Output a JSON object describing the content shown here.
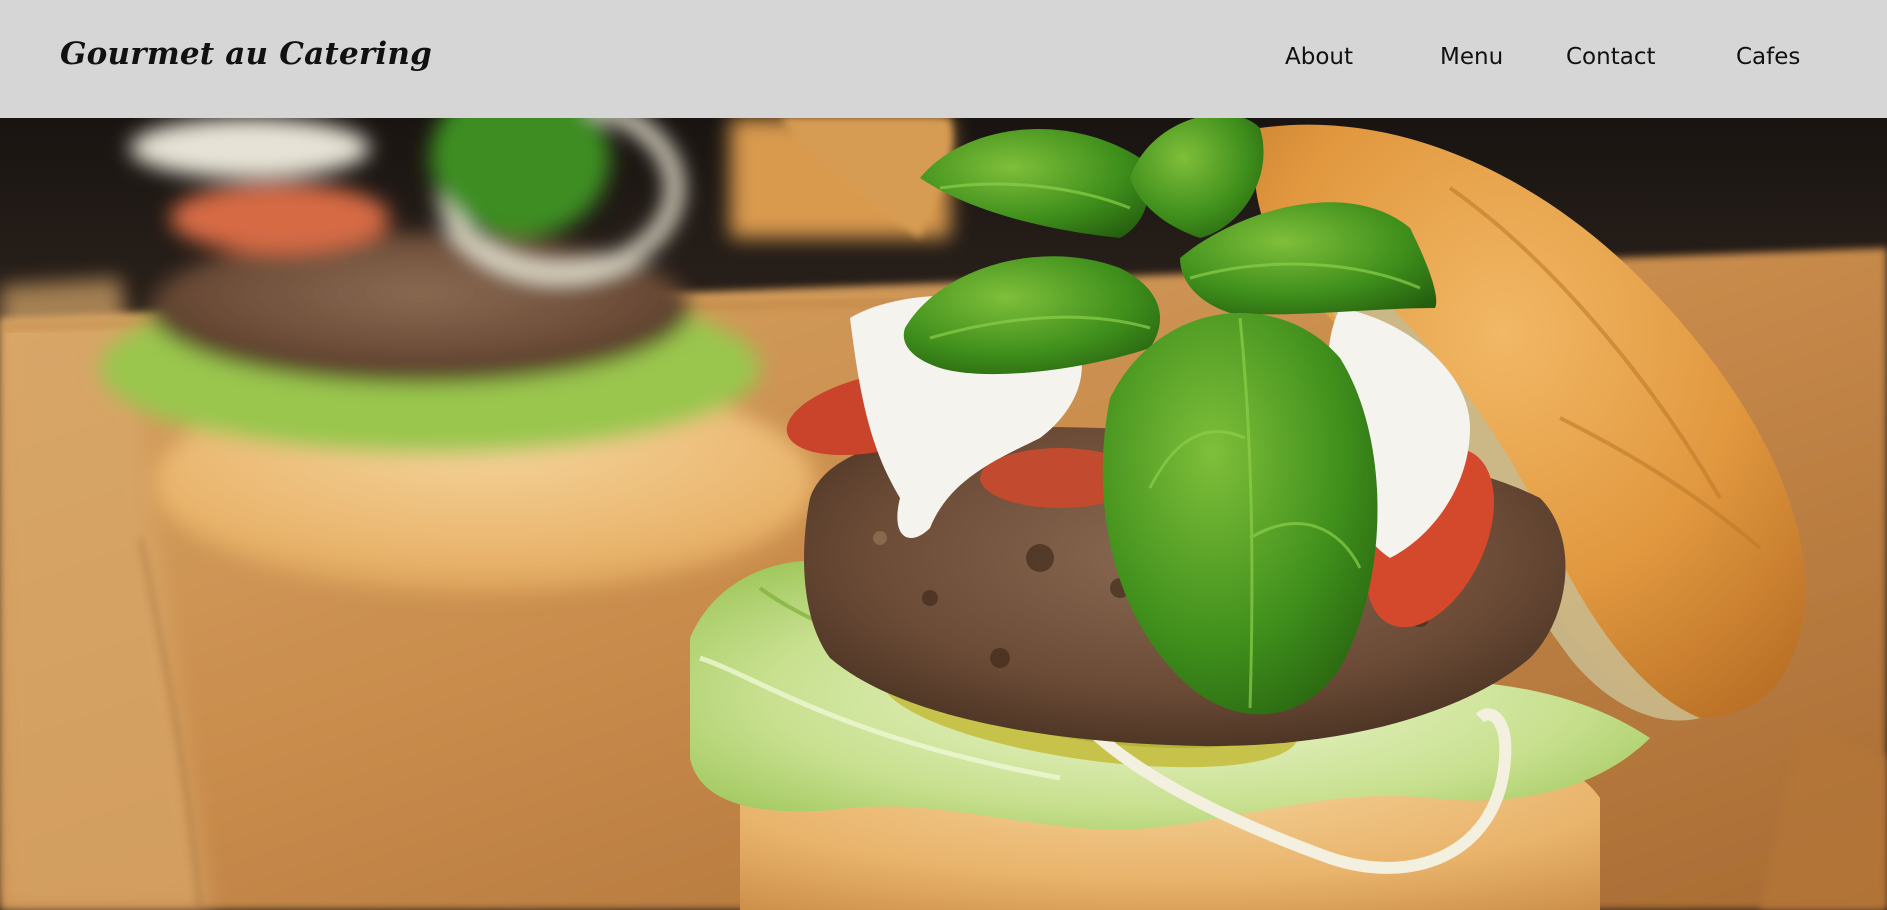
{
  "header": {
    "brand": "Gourmet au Catering",
    "nav": [
      {
        "label": "About"
      },
      {
        "label": "Menu"
      },
      {
        "label": "Contact"
      },
      {
        "label": "Cafes"
      }
    ]
  },
  "hero": {
    "image_subject": "burger-photo"
  },
  "colors": {
    "header_bg": "#d6d6d6",
    "text": "#111111"
  }
}
